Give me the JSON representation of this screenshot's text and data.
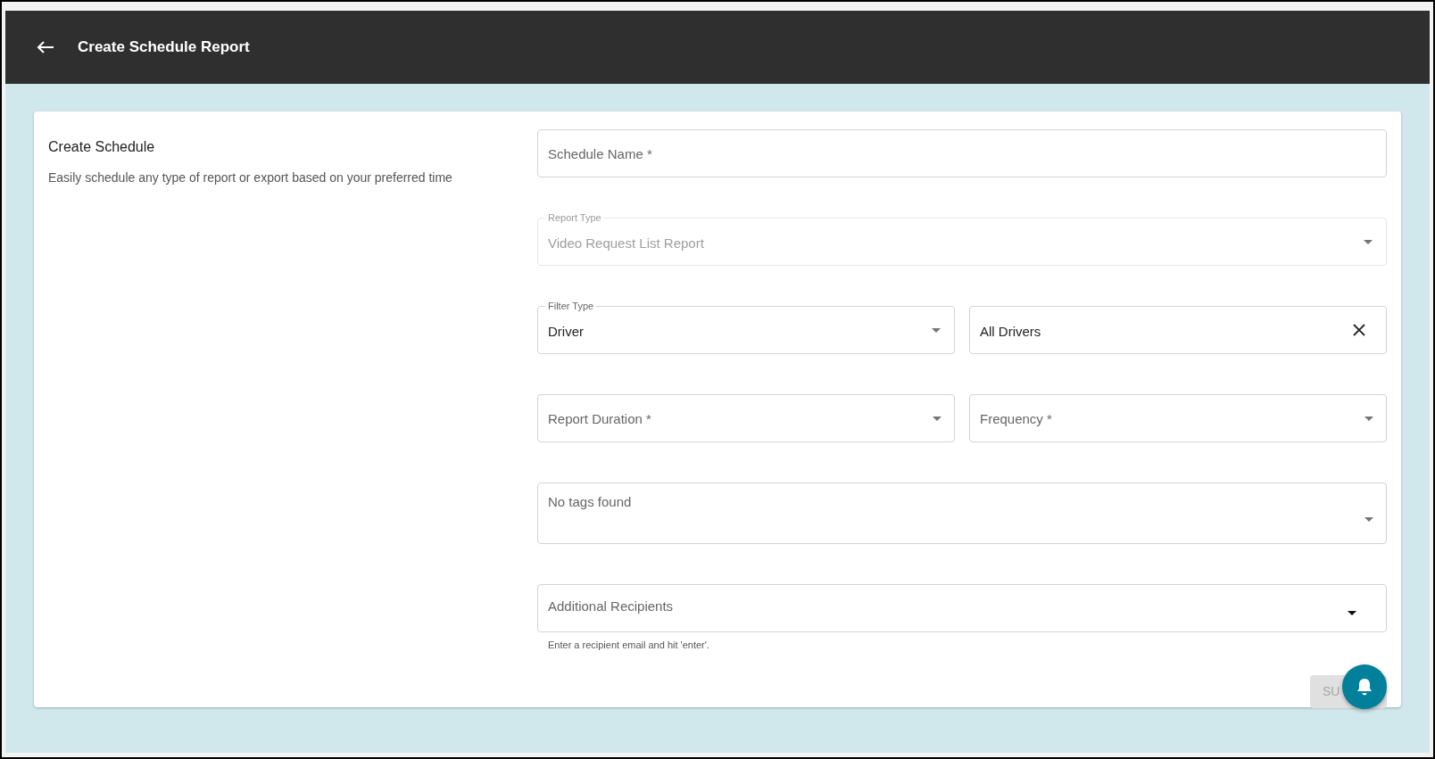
{
  "header": {
    "title": "Create Schedule Report"
  },
  "intro": {
    "title": "Create Schedule",
    "description": "Easily schedule any type of report or export based on your preferred time"
  },
  "rows": [
    [
      {
        "kind": "text",
        "placeholder": "Schedule Name *"
      }
    ],
    [
      {
        "kind": "select",
        "label": "Report Type",
        "value": "Video Request List Report",
        "disabled": true
      }
    ],
    [
      {
        "kind": "select",
        "label": "Filter Type",
        "value": "Driver",
        "disabled": false
      },
      {
        "kind": "clearable",
        "value": "All Drivers"
      }
    ],
    [
      {
        "kind": "placeholder-select",
        "placeholder": "Report Duration *"
      },
      {
        "kind": "placeholder-select",
        "placeholder": "Frequency *"
      }
    ],
    [
      {
        "kind": "tags",
        "placeholder": "No tags found"
      }
    ],
    [
      {
        "kind": "combo",
        "placeholder": "Additional Recipients",
        "helper": "Enter a recipient email and hit 'enter'."
      }
    ]
  ],
  "submit": {
    "label": "SU",
    "disabled": true
  }
}
